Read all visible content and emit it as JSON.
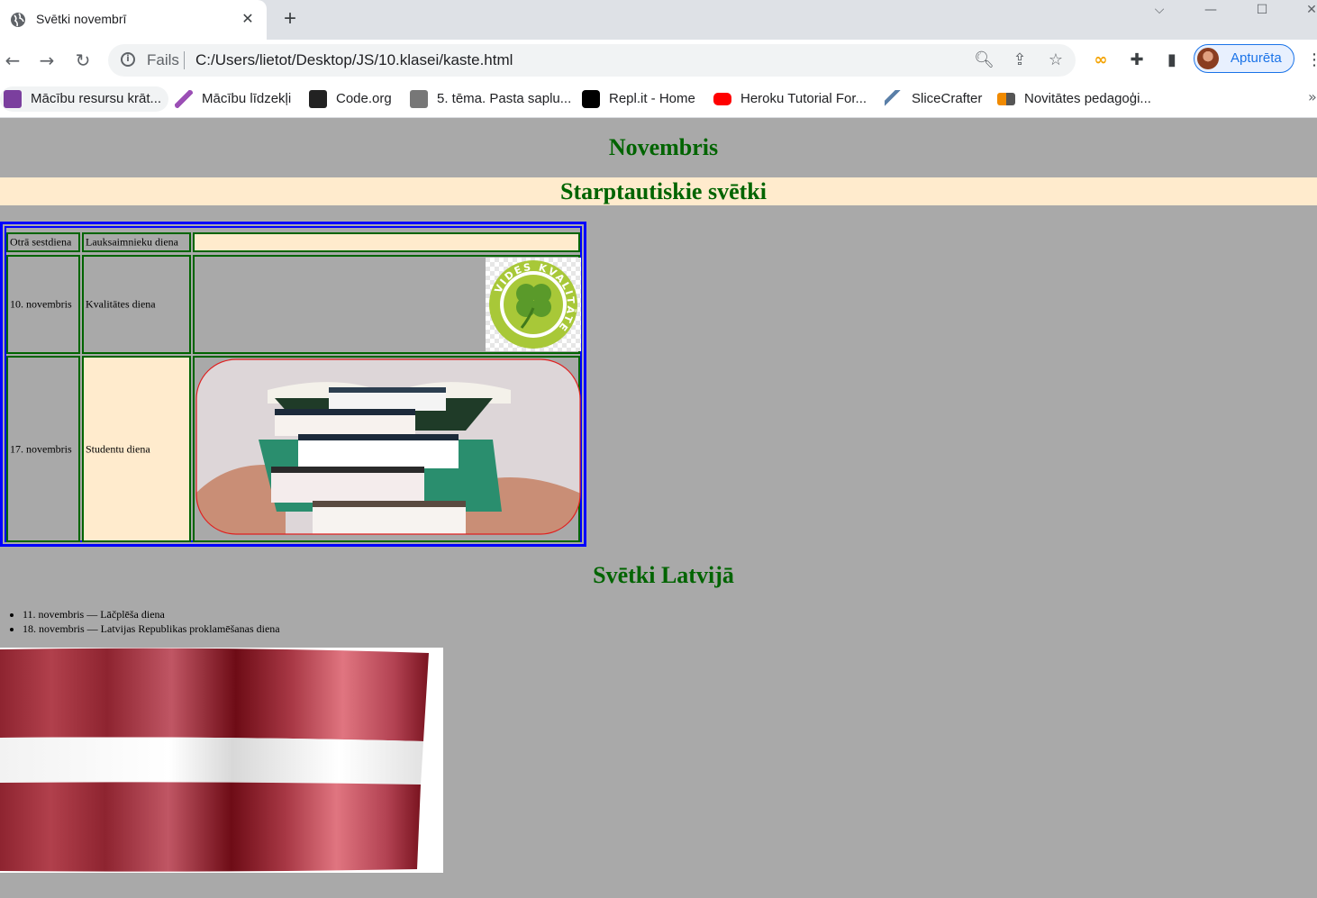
{
  "browser": {
    "tab_title": "Svētki novembrī",
    "address_prefix": "Fails",
    "url": "C:/Users/lietot/Desktop/JS/10.klasei/kaste.html",
    "profile_label": "Apturēta",
    "bookmarks": [
      "Mācību resursu krāt...",
      "Mācību līdzekļi",
      "Code.org",
      "5. tēma. Pasta saplu...",
      "Repl.it - Home",
      "Heroku Tutorial For...",
      "SliceCrafter",
      "Novitātes pedagoģi..."
    ]
  },
  "page": {
    "heading": "Novembris",
    "intl_heading": "Starptautiskie svētki",
    "table": {
      "row1": {
        "c1": "Otrā sestdiena",
        "c2": "Lauksaimnieku diena",
        "c3": ""
      },
      "row2": {
        "c1": "10. novembris",
        "c2": "Kvalitātes diena",
        "logo_text": "VIDES KVALITĀTE"
      },
      "row3": {
        "c1": "17. novembris",
        "c2": "Studentu diena"
      }
    },
    "lv_heading": "Svētki Latvijā",
    "lv_holidays": [
      "11. novembris — Lāčplēša diena",
      "18. novembris — Latvijas Republikas proklamēšanas diena"
    ]
  },
  "colors": {
    "page_bg": "#a9a9a9",
    "heading": "#006400",
    "highlight_bg": "#ffebcd",
    "table_outer_border": "#0000ff",
    "cell_border": "#006400",
    "flag_red": "#9e3039"
  }
}
